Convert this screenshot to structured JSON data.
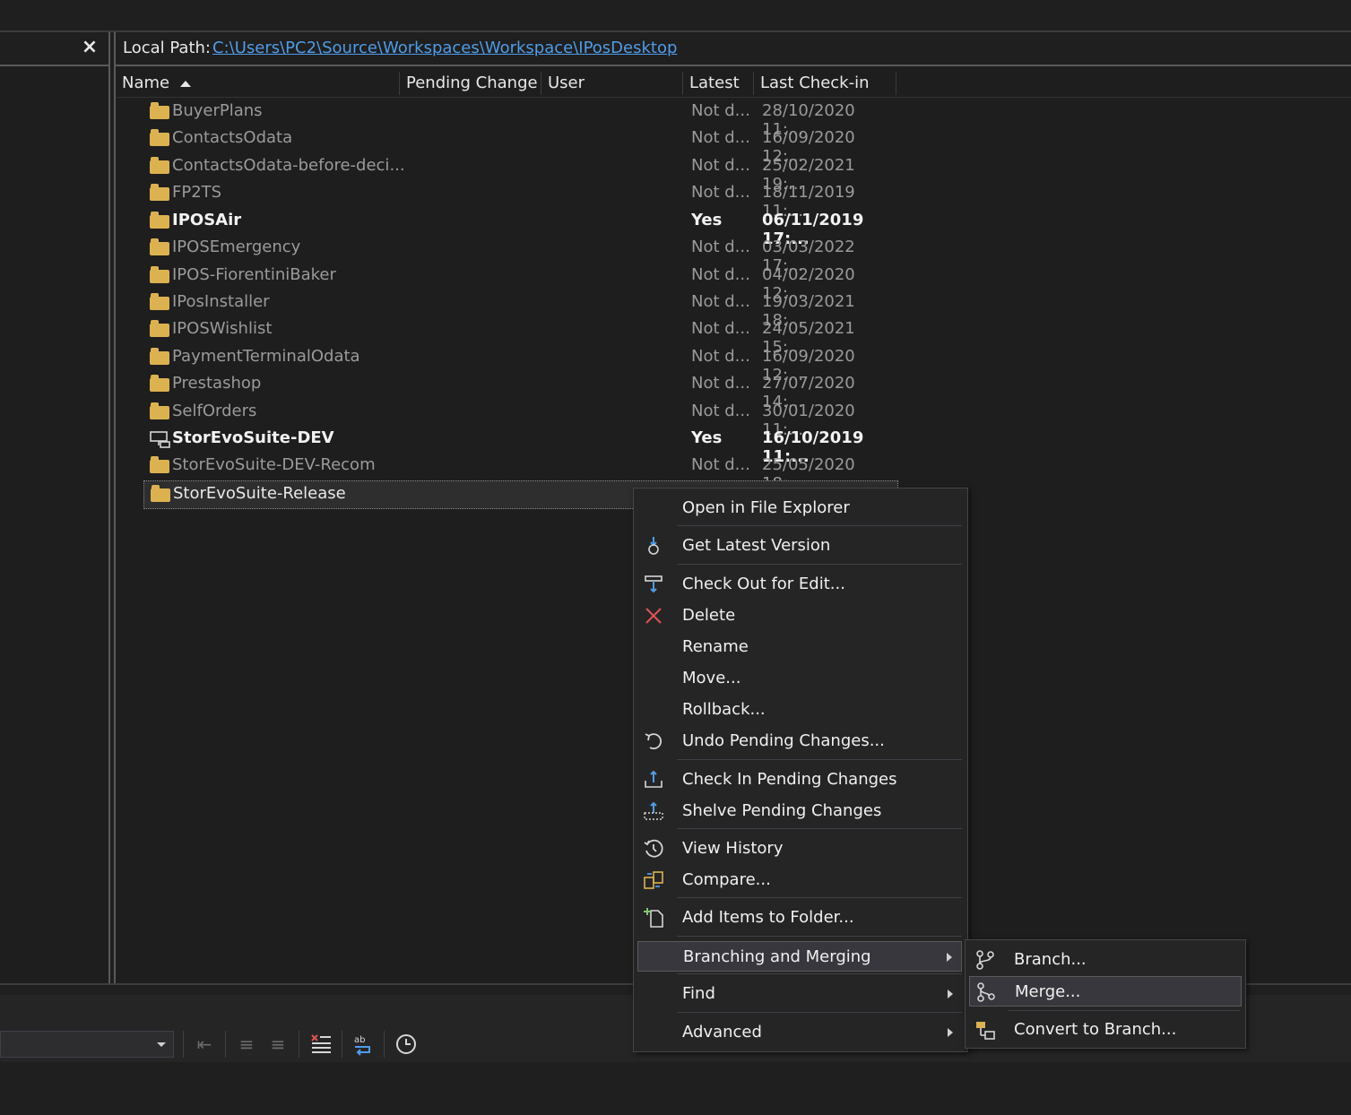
{
  "header": {
    "close_glyph": "×",
    "local_path_label": "Local Path:",
    "local_path_value": "C:\\Users\\PC2\\Source\\Workspaces\\Workspace\\IPosDesktop"
  },
  "columns": {
    "name": "Name",
    "pending_change": "Pending Change",
    "user": "User",
    "latest": "Latest",
    "last_checkin": "Last Check-in"
  },
  "items": [
    {
      "name": "BuyerPlans",
      "latest": "Not d...",
      "last_checkin": "28/10/2020 11:..."
    },
    {
      "name": "ContactsOdata",
      "latest": "Not d...",
      "last_checkin": "16/09/2020 12:..."
    },
    {
      "name": "ContactsOdata-before-deci...",
      "latest": "Not d...",
      "last_checkin": "25/02/2021 19:..."
    },
    {
      "name": "FP2TS",
      "latest": "Not d...",
      "last_checkin": "18/11/2019 11:..."
    },
    {
      "name": "IPOSAir",
      "latest": "Yes",
      "last_checkin": "06/11/2019 17:..."
    },
    {
      "name": "IPOSEmergency",
      "latest": "Not d...",
      "last_checkin": "03/03/2022 17:..."
    },
    {
      "name": "IPOS-FiorentiniBaker",
      "latest": "Not d...",
      "last_checkin": "04/02/2020 12:..."
    },
    {
      "name": "IPosInstaller",
      "latest": "Not d...",
      "last_checkin": "19/03/2021 18:..."
    },
    {
      "name": "IPOSWishlist",
      "latest": "Not d...",
      "last_checkin": "24/05/2021 15:..."
    },
    {
      "name": "PaymentTerminalOdata",
      "latest": "Not d...",
      "last_checkin": "16/09/2020 12:..."
    },
    {
      "name": "Prestashop",
      "latest": "Not d...",
      "last_checkin": "27/07/2020 14:..."
    },
    {
      "name": "SelfOrders",
      "latest": "Not d...",
      "last_checkin": "30/01/2020 11:..."
    },
    {
      "name": "StorEvoSuite-DEV",
      "latest": "Yes",
      "last_checkin": "16/10/2019 11:..."
    },
    {
      "name": "StorEvoSuite-DEV-Recom",
      "latest": "Not d...",
      "last_checkin": "25/05/2020 18:..."
    },
    {
      "name": "StorEvoSuite-Release",
      "latest": "",
      "last_checkin": ""
    }
  ],
  "context_menu": {
    "open_in_explorer": "Open in File Explorer",
    "get_latest": "Get Latest Version",
    "check_out": "Check Out for Edit...",
    "delete": "Delete",
    "rename": "Rename",
    "move": "Move...",
    "rollback": "Rollback...",
    "undo_pending": "Undo Pending Changes...",
    "check_in": "Check In Pending Changes",
    "shelve": "Shelve Pending Changes",
    "view_history": "View History",
    "compare": "Compare...",
    "add_items": "Add Items to Folder...",
    "branching": "Branching and Merging",
    "find": "Find",
    "advanced": "Advanced"
  },
  "submenu": {
    "branch": "Branch...",
    "merge": "Merge...",
    "convert": "Convert to Branch..."
  },
  "colors": {
    "background": "#1e1e1e",
    "menu_bg": "#252526",
    "link": "#4f9ce8",
    "folder": "#dcb250",
    "delete_red": "#e05252"
  }
}
